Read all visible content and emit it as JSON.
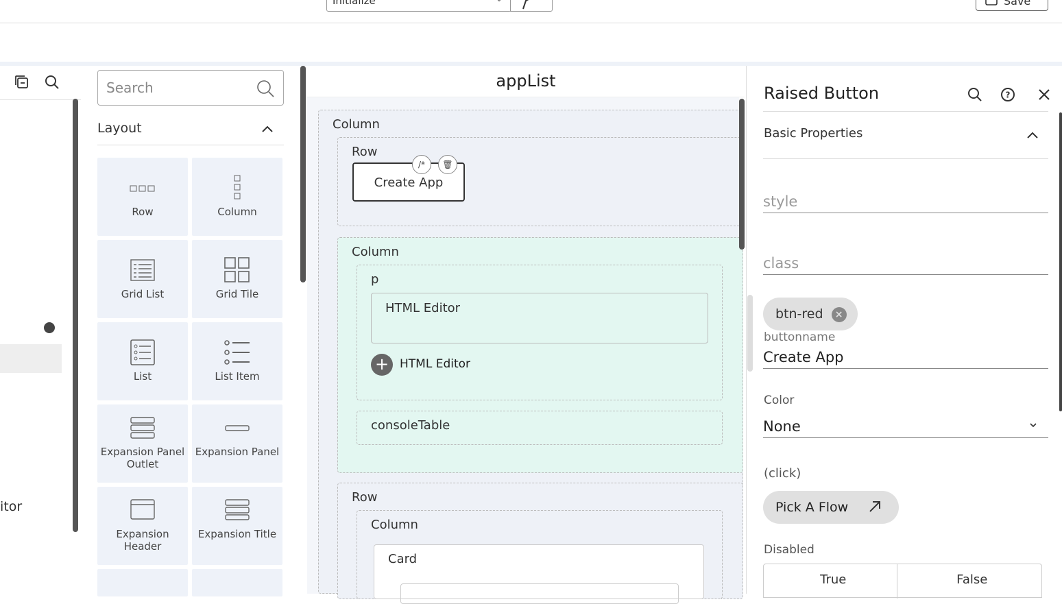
{
  "topbar": {
    "step_select_value": "Initialize",
    "save_label": "Save"
  },
  "left_panel": {
    "partial_text": "itor"
  },
  "widgets": {
    "search_placeholder": "Search",
    "section_title": "Layout",
    "tiles": [
      {
        "label": "Row",
        "icon": "row-icon"
      },
      {
        "label": "Column",
        "icon": "column-icon"
      },
      {
        "label": "Grid List",
        "icon": "grid-list-icon"
      },
      {
        "label": "Grid Tile",
        "icon": "grid-tile-icon"
      },
      {
        "label": "List",
        "icon": "list-icon"
      },
      {
        "label": "List Item",
        "icon": "list-item-icon"
      },
      {
        "label": "Expansion Panel Outlet",
        "icon": "expansion-panel-outlet-icon"
      },
      {
        "label": "Expansion Panel",
        "icon": "expansion-panel-icon"
      },
      {
        "label": "Expansion Header",
        "icon": "expansion-header-icon"
      },
      {
        "label": "Expansion Title",
        "icon": "expansion-title-icon"
      }
    ]
  },
  "canvas": {
    "title": "appList",
    "column1": "Column",
    "row1": "Row",
    "create_btn": "Create App",
    "column2": "Column",
    "p_label": "p",
    "html_editor": "HTML Editor",
    "add_html_editor": "HTML Editor",
    "console_table": "consoleTable",
    "row2": "Row",
    "column3": "Column",
    "card": "Card"
  },
  "props": {
    "title": "Raised Button",
    "section": "Basic Properties",
    "style_label": "style",
    "class_label": "class",
    "chip": "btn-red",
    "buttonname_label": "buttonname",
    "buttonname_value": "Create App",
    "color_label": "Color",
    "color_value": "None",
    "click_label": "(click)",
    "pick_flow": "Pick A Flow",
    "disabled_label": "Disabled",
    "true_label": "True",
    "false_label": "False"
  }
}
